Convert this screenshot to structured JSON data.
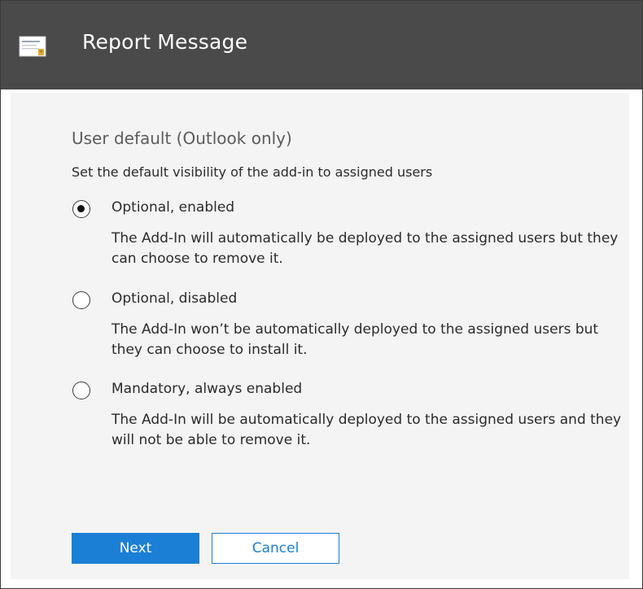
{
  "window": {
    "title": "Report Message",
    "icon": "report-message-icon"
  },
  "section": {
    "title": "User default (Outlook only)",
    "description": "Set the default visibility of the add-in to assigned users"
  },
  "options": [
    {
      "label": "Optional, enabled",
      "description": "The Add-In will automatically be deployed to the assigned users but they can choose to remove it.",
      "selected": true
    },
    {
      "label": "Optional, disabled",
      "description": "The Add-In won’t be automatically deployed to the assigned users but they can choose to install it.",
      "selected": false
    },
    {
      "label": "Mandatory, always enabled",
      "description": "The Add-In will be automatically deployed to the assigned users and they will not be able to remove it.",
      "selected": false
    }
  ],
  "buttons": {
    "next_label": "Next",
    "cancel_label": "Cancel"
  },
  "colors": {
    "header_bg": "#4a4a4a",
    "panel_bg": "#f4f4f4",
    "accent": "#1b7fd6"
  }
}
